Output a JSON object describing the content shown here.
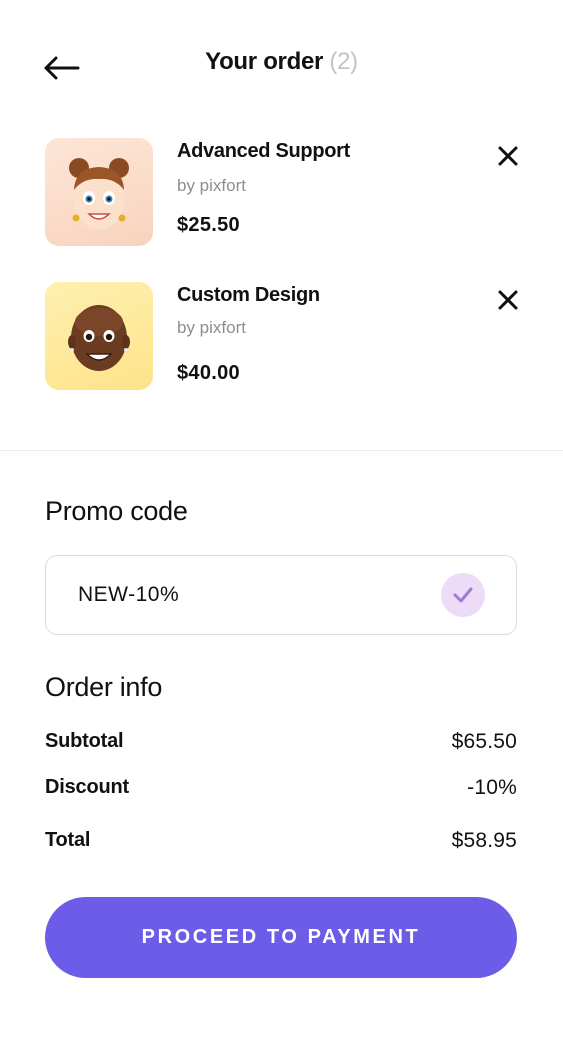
{
  "header": {
    "back_icon": "arrow-left-icon",
    "title": "Your order",
    "count": "(2)"
  },
  "items": [
    {
      "name": "Advanced Support",
      "vendor": "by pixfort",
      "price": "$25.50",
      "avatar": "girl-avatar-emoji",
      "thumb_color": "#f9dcc9",
      "remove_icon": "close-icon"
    },
    {
      "name": "Custom Design",
      "vendor": "by pixfort",
      "price": "$40.00",
      "avatar": "man-avatar-emoji",
      "thumb_color": "#fee79a",
      "remove_icon": "close-icon"
    }
  ],
  "promo": {
    "label": "Promo code",
    "value": "NEW-10%",
    "check_icon": "check-icon",
    "check_color": "#ecdcf8"
  },
  "order_info": {
    "label": "Order info",
    "subtotal_label": "Subtotal",
    "subtotal_value": "$65.50",
    "discount_label": "Discount",
    "discount_value": "-10%",
    "total_label": "Total",
    "total_value": "$58.95"
  },
  "cta": {
    "label": "PROCEED TO PAYMENT",
    "color": "#6c5ce8"
  }
}
